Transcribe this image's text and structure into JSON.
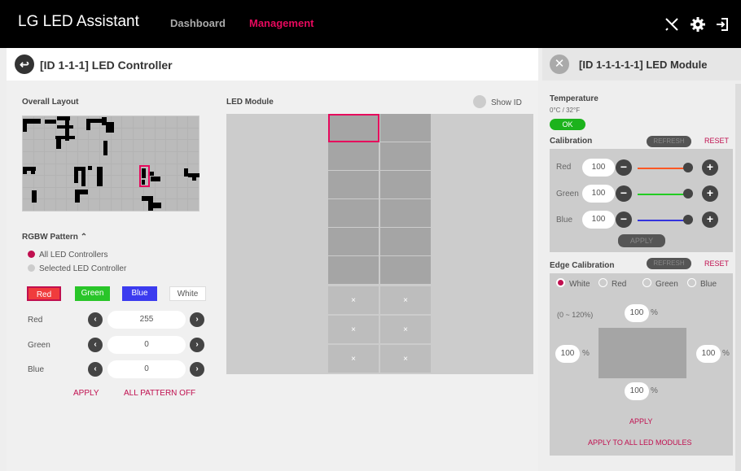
{
  "app": {
    "brand": "LG LED Assistant",
    "nav": [
      "Dashboard",
      "Management"
    ],
    "icons": [
      "tools-icon",
      "gear-icon",
      "logout-icon"
    ]
  },
  "controller": {
    "title": "[ID 1-1-1] LED Controller",
    "overall_layout": "Overall Layout",
    "led_module": "LED Module",
    "show_id": "Show ID",
    "rgbw": {
      "title": "RGBW Pattern",
      "options": [
        "All LED Controllers",
        "Selected LED Controller"
      ],
      "colors": [
        "Red",
        "Green",
        "Blue",
        "White"
      ],
      "rows": [
        {
          "label": "Red",
          "value": "255"
        },
        {
          "label": "Green",
          "value": "0"
        },
        {
          "label": "Blue",
          "value": "0"
        }
      ],
      "apply": "APPLY",
      "all_off": "ALL PATTERN OFF"
    },
    "module_marks": [
      "×",
      "×",
      "×",
      "×",
      "×",
      "×"
    ]
  },
  "module": {
    "title": "[ID 1-1-1-1-1] LED Module",
    "temperature": {
      "label": "Temperature",
      "value": "0°C / 32°F",
      "status": "OK"
    },
    "calibration": {
      "label": "Calibration",
      "refresh": "REFRESH",
      "reset": "RESET",
      "rows": [
        {
          "label": "Red",
          "value": "100",
          "color": "#ff5722"
        },
        {
          "label": "Green",
          "value": "100",
          "color": "#22cc22"
        },
        {
          "label": "Blue",
          "value": "100",
          "color": "#3333dd"
        }
      ],
      "apply": "APPLY"
    },
    "edge": {
      "label": "Edge Calibration",
      "refresh": "REFRESH",
      "reset": "RESET",
      "options": [
        "White",
        "Red",
        "Green",
        "Blue"
      ],
      "range": "(0 ~ 120%)",
      "top": "100",
      "left": "100",
      "right": "100",
      "bottom": "100",
      "unit": "%",
      "apply": "APPLY",
      "apply_all": "APPLY TO ALL LED MODULES"
    }
  },
  "colors": {
    "accent": "#e6095d",
    "ok": "#1cb31c"
  }
}
